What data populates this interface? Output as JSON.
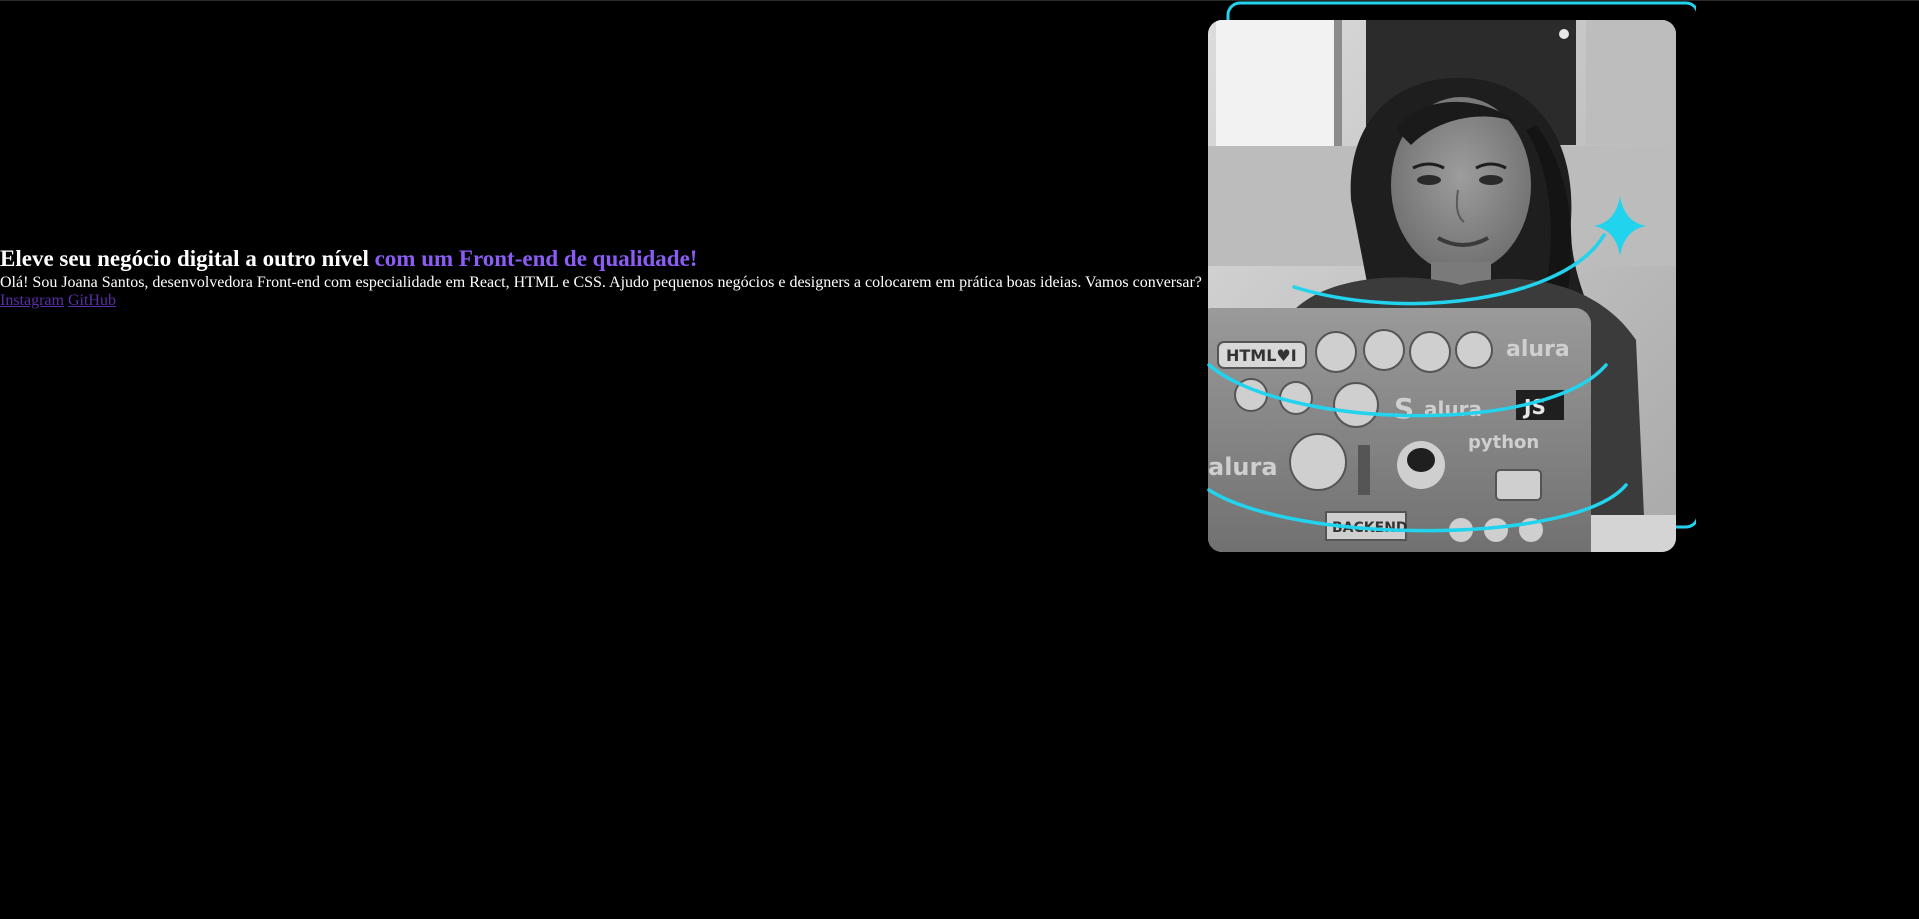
{
  "hero": {
    "headline_main": "Eleve seu negócio digital a outro nível ",
    "headline_accent": "com um Front-end de qualidade!",
    "description": "Olá! Sou Joana Santos, desenvolvedora Front-end com especialidade em React, HTML e CSS. Ajudo pequenos negócios e designers a colocarem em prática boas ideias. Vamos conversar?",
    "links": {
      "instagram": "Instagram",
      "github": "GitHub"
    }
  },
  "sticker_text": {
    "html": "HTML♥I",
    "alura_1": "alura",
    "alura_2": "alura",
    "alura_3": "alura",
    "js": "JS",
    "python": "python",
    "backend": "BACKEND"
  },
  "colors": {
    "background": "#000000",
    "text": "#ffffff",
    "accent": "#8b5cf6",
    "link": "#5b2ea8",
    "frame": "#22d3ee"
  },
  "icons": {
    "sparkle": "four-point-star-icon"
  }
}
